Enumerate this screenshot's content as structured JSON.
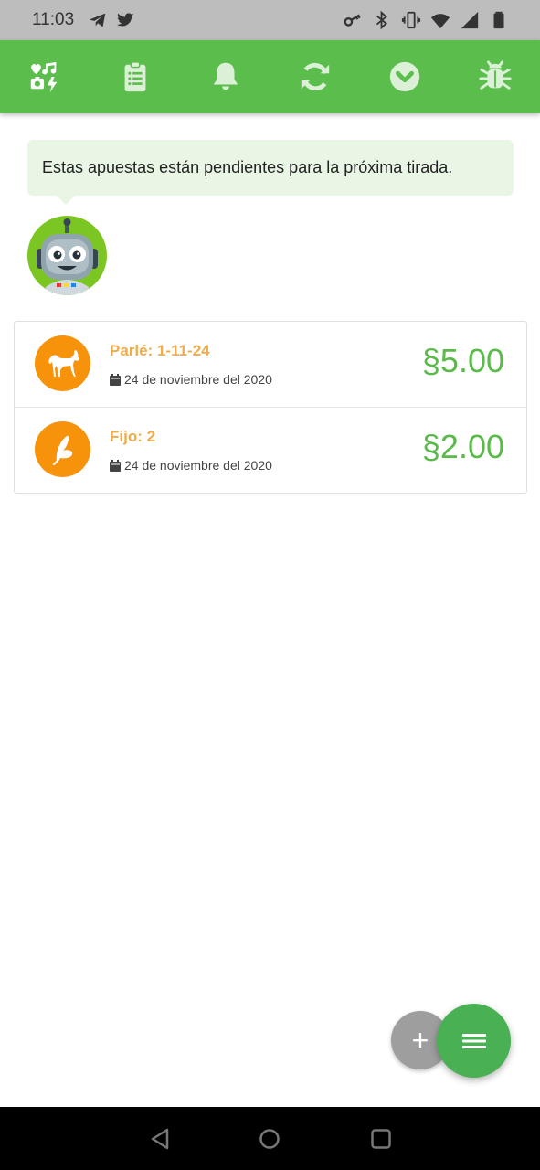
{
  "status_bar": {
    "time": "11:03",
    "left_icons": [
      "telegram-icon",
      "twitter-icon"
    ],
    "right_icons": [
      "vpn-key-icon",
      "bluetooth-icon",
      "vibrate-icon",
      "wifi-icon",
      "signal-icon",
      "battery-icon"
    ]
  },
  "toolbar": {
    "items": [
      {
        "name": "games-icon",
        "active": true
      },
      {
        "name": "clipboard-list-icon",
        "active": false
      },
      {
        "name": "bell-icon",
        "active": false
      },
      {
        "name": "sync-icon",
        "active": false
      },
      {
        "name": "chevron-circle-down-icon",
        "active": false
      },
      {
        "name": "bug-icon",
        "active": false
      }
    ],
    "color": "#5bbd4c"
  },
  "bubble": {
    "message": "Estas apuestas están pendientes para la próxima tirada."
  },
  "bets": [
    {
      "title": "Parlé: 1-11-24",
      "date": "24 de noviembre del 2020",
      "amount": "§5.00",
      "icon": "horse-icon"
    },
    {
      "title": "Fijo: 2",
      "date": "24 de noviembre del 2020",
      "amount": "§2.00",
      "icon": "butterfly-icon"
    }
  ],
  "fabs": {
    "add_label": "+",
    "menu_icon": "menu-icon"
  },
  "colors": {
    "accent_green": "#5bbd4c",
    "amount_green": "#5aba4a",
    "avatar_orange": "#f7920b",
    "title_orange": "#f0ac4a",
    "bubble_bg": "#e9f6e6"
  }
}
